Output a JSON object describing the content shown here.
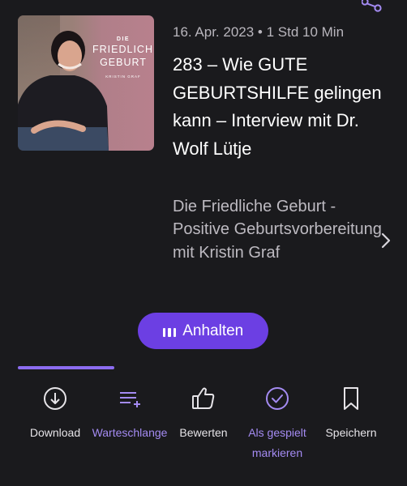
{
  "episode": {
    "meta": "16. Apr. 2023 • 1 Std 10 Min",
    "title": "283 – Wie GUTE GEBURTSHILFE gelingen kann – Interview mit Dr. Wolf Lütje",
    "podcast_name": "Die Friedliche Geburt - Positive Geburtsvorbereitung mit Kristin Graf"
  },
  "cover": {
    "line1": "DIE",
    "line2": "FRIEDLICHE",
    "line3": "GEBURT",
    "author": "KRISTIN GRAF"
  },
  "player": {
    "pause_label": "Anhalten",
    "progress_fraction": 0.26
  },
  "actions": [
    {
      "label": "Download",
      "icon": "download-icon"
    },
    {
      "label": "Warteschlange",
      "icon": "queue-add-icon"
    },
    {
      "label": "Bewerten",
      "icon": "thumbs-up-icon"
    },
    {
      "label": "Als gespielt markieren",
      "icon": "check-circle-icon"
    },
    {
      "label": "Speichern",
      "icon": "bookmark-icon"
    }
  ],
  "icons": {
    "share": "share-icon",
    "chevron": "chevron-right-icon"
  },
  "colors": {
    "background": "#1a1a1d",
    "accent": "#6c3fe3",
    "accent_text": "#a48bf2",
    "progress": "#8c6cf0"
  }
}
